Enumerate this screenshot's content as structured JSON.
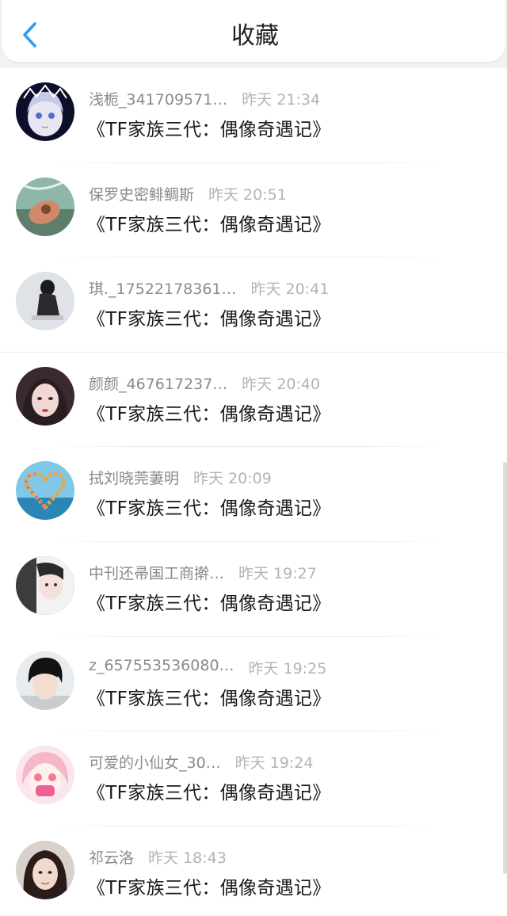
{
  "header": {
    "title": "收藏",
    "back_icon": "chevron-left-icon",
    "accent": "#2d9cf0"
  },
  "items": [
    {
      "name": "浅栀_341709571…",
      "time": "昨天 21:34",
      "work": "《TF家族三代：偶像奇遇记》"
    },
    {
      "name": "保罗史密鲱鲷斯",
      "time": "昨天 20:51",
      "work": "《TF家族三代：偶像奇遇记》"
    },
    {
      "name": "琪._17522178361…",
      "time": "昨天 20:41",
      "work": "《TF家族三代：偶像奇遇记》"
    },
    {
      "name": "颜颜_467617237…",
      "time": "昨天 20:40",
      "work": "《TF家族三代：偶像奇遇记》"
    },
    {
      "name": "拭刘晓莞萋明",
      "time": "昨天 20:09",
      "work": "《TF家族三代：偶像奇遇记》"
    },
    {
      "name": "中刊还帚国工商擀…",
      "time": "昨天 19:27",
      "work": "《TF家族三代：偶像奇遇记》"
    },
    {
      "name": "z_657553536080…",
      "time": "昨天 19:25",
      "work": "《TF家族三代：偶像奇遇记》"
    },
    {
      "name": "可爱的小仙女_30…",
      "time": "昨天 19:24",
      "work": "《TF家族三代：偶像奇遇记》"
    },
    {
      "name": "祁云洛",
      "time": "昨天 18:43",
      "work": "《TF家族三代：偶像奇遇记》"
    }
  ],
  "colors": {
    "name": "#8a8a8a",
    "time": "#b3b3b3",
    "work": "#1a1a1a",
    "header_bg": "#f2f2f2"
  }
}
